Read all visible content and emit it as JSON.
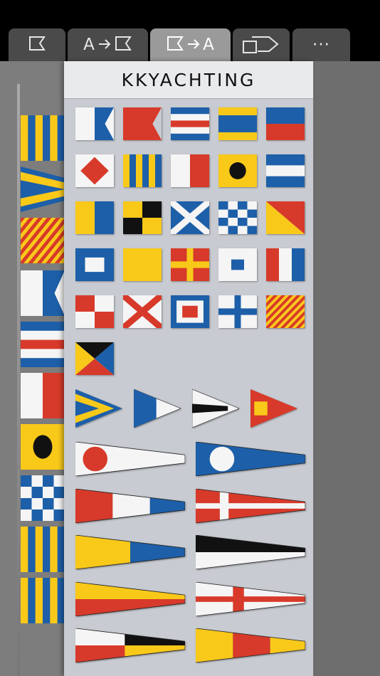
{
  "tabs": [
    {
      "name": "tab-flag",
      "label": "",
      "active": false
    },
    {
      "name": "tab-text-to-flag",
      "label": "A",
      "active": false
    },
    {
      "name": "tab-flag-to-text",
      "label": "A",
      "active": true
    },
    {
      "name": "tab-shapes",
      "label": "",
      "active": false
    },
    {
      "name": "tab-more",
      "label": "···",
      "active": false
    }
  ],
  "panel": {
    "title": "KKYACHTING"
  },
  "colors": {
    "yellow": "#f9c91a",
    "blue": "#1d5fa8",
    "red": "#d73a2a",
    "white": "#f5f5f5",
    "black": "#111111"
  },
  "flags": [
    {
      "icon": "flag-alfa"
    },
    {
      "icon": "flag-bravo"
    },
    {
      "icon": "flag-charlie"
    },
    {
      "icon": "flag-delta"
    },
    {
      "icon": "flag-echo"
    },
    {
      "icon": "flag-foxtrot"
    },
    {
      "icon": "flag-golf"
    },
    {
      "icon": "flag-hotel"
    },
    {
      "icon": "flag-india"
    },
    {
      "icon": "flag-juliett"
    },
    {
      "icon": "flag-kilo"
    },
    {
      "icon": "flag-lima"
    },
    {
      "icon": "flag-mike"
    },
    {
      "icon": "flag-november"
    },
    {
      "icon": "flag-oscar"
    },
    {
      "icon": "flag-papa"
    },
    {
      "icon": "flag-quebec"
    },
    {
      "icon": "flag-romeo"
    },
    {
      "icon": "flag-sierra"
    },
    {
      "icon": "flag-tango"
    },
    {
      "icon": "flag-uniform"
    },
    {
      "icon": "flag-victor"
    },
    {
      "icon": "flag-whiskey"
    },
    {
      "icon": "flag-xray"
    },
    {
      "icon": "flag-yankee"
    },
    {
      "icon": "flag-zulu"
    }
  ],
  "substitutes": [
    {
      "icon": "pennant-substitute-1"
    },
    {
      "icon": "pennant-substitute-2"
    },
    {
      "icon": "pennant-substitute-3"
    },
    {
      "icon": "pennant-answer"
    }
  ],
  "pennants": [
    {
      "icon": "pennant-1"
    },
    {
      "icon": "pennant-2"
    },
    {
      "icon": "pennant-3"
    },
    {
      "icon": "pennant-4"
    },
    {
      "icon": "pennant-5"
    },
    {
      "icon": "pennant-6"
    },
    {
      "icon": "pennant-7"
    },
    {
      "icon": "pennant-8"
    },
    {
      "icon": "pennant-9"
    },
    {
      "icon": "pennant-0"
    }
  ],
  "preview": [
    {
      "icon": "flag-golf"
    },
    {
      "icon": "pennant-substitute-1"
    },
    {
      "icon": "flag-yankee"
    },
    {
      "icon": "flag-alfa"
    },
    {
      "icon": "flag-charlie"
    },
    {
      "icon": "flag-hotel"
    },
    {
      "icon": "flag-india"
    },
    {
      "icon": "flag-november"
    },
    {
      "icon": "flag-golf"
    }
  ]
}
